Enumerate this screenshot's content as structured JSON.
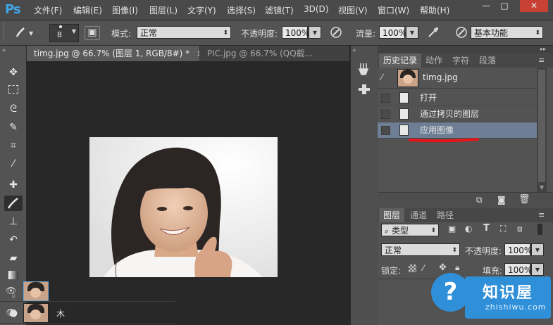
{
  "app": {
    "logo": "Ps"
  },
  "menu": [
    "文件(F)",
    "编辑(E)",
    "图像(I)",
    "图层(L)",
    "文字(Y)",
    "选择(S)",
    "滤镜(T)",
    "3D(D)",
    "视图(V)",
    "窗口(W)",
    "帮助(H)"
  ],
  "window_controls": {
    "minimize": "—",
    "maximize": "□",
    "close": "✕"
  },
  "options": {
    "brush_size": "8",
    "mode_label": "模式:",
    "mode_value": "正常",
    "opacity_label": "不透明度:",
    "opacity_value": "100%",
    "flow_label": "流量:",
    "flow_value": "100%",
    "workspace": "基本功能"
  },
  "tabs": [
    {
      "label": "timg.jpg @ 66.7% (图层 1, RGB/8#) *",
      "close": "×"
    },
    {
      "label": "PIC.jpg @ 66.7% (QQ截..."
    }
  ],
  "history_panel": {
    "tabs": [
      "历史记录",
      "动作",
      "字符",
      "段落"
    ],
    "snapshot_name": "timg.jpg",
    "items": [
      {
        "label": "打开"
      },
      {
        "label": "通过拷贝的图层"
      },
      {
        "label": "应用图像"
      }
    ],
    "selected_index": 2
  },
  "layers_panel": {
    "tabs": [
      "图层",
      "通道",
      "路径"
    ],
    "filter_kind": "类型",
    "blend_mode": "正常",
    "opacity_label": "不透明度:",
    "opacity_value": "100%",
    "lock_label": "锁定:",
    "fill_label": "填充:",
    "fill_value": "100%",
    "layer_name_partial": "木"
  },
  "watermark": {
    "title": "知识屋",
    "url": "zhishiwu.com",
    "symbol": "?"
  },
  "colors": {
    "menubar": "#4a4a4a",
    "panel": "#535353",
    "canvas": "#282828",
    "selection": "#6e7f95",
    "annotation_red": "#e8141b",
    "watermark_blue": "#2f8fd8"
  },
  "icons": {
    "toolbar": [
      "move-icon",
      "marquee-icon",
      "lasso-icon",
      "quick-select-icon",
      "crop-icon",
      "eyedropper-icon",
      "healing-icon",
      "brush-icon",
      "stamp-icon",
      "history-brush-icon",
      "eraser-icon",
      "gradient-icon",
      "blur-icon",
      "dodge-icon"
    ]
  }
}
